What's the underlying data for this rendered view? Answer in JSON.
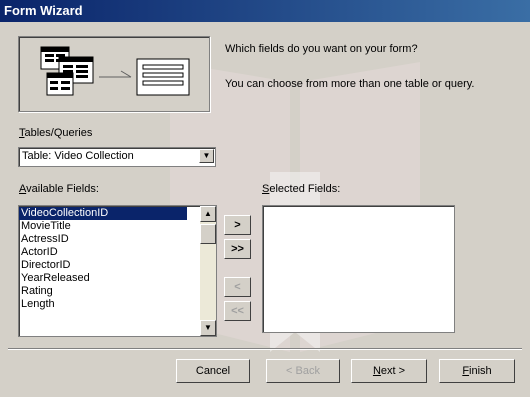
{
  "window": {
    "title": "Form Wizard"
  },
  "intro": {
    "question": "Which fields do you want on your form?",
    "hint": "You can choose from more than one table or query."
  },
  "tables_queries": {
    "label_ul": "T",
    "label_rest": "ables/Queries",
    "selected": "Table: Video Collection"
  },
  "available_fields": {
    "label_ul": "A",
    "label_rest": "vailable Fields:",
    "items": [
      "VideoCollectionID",
      "MovieTitle",
      "ActressID",
      "ActorID",
      "DirectorID",
      "YearReleased",
      "Rating",
      "Length"
    ],
    "selected_index": 0
  },
  "selected_fields": {
    "label_ul": "S",
    "label_rest": "elected Fields:",
    "items": []
  },
  "move_buttons": {
    "add_one": ">",
    "add_all": ">>",
    "remove_one": "<",
    "remove_all": "<<"
  },
  "footer": {
    "cancel": "Cancel",
    "back": "< Back",
    "next_ul": "N",
    "next_rest": "ext >",
    "finish_ul": "F",
    "finish_rest": "inish"
  },
  "colors": {
    "titlebar": "#0a246a",
    "dialog_bg": "#d4d0c8",
    "selection": "#0a246a"
  }
}
